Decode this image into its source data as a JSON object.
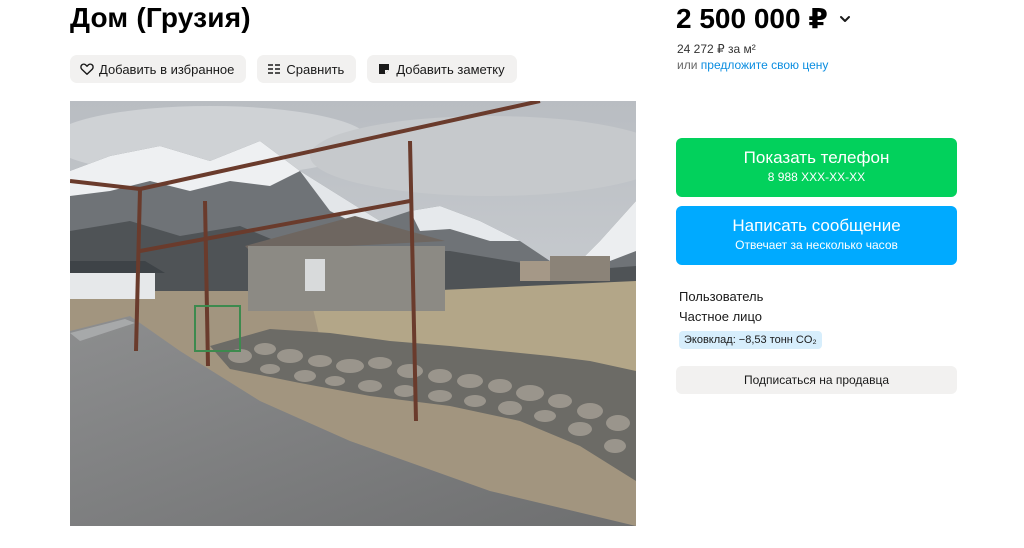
{
  "listing": {
    "title": "Дом (Грузия)",
    "price": "2 500 000 ₽",
    "price_per_m2": "24 272 ₽ за м²",
    "offer_prefix": "или",
    "offer_link": "предложите свою цену"
  },
  "actions": {
    "favorite": "Добавить в избранное",
    "compare": "Сравнить",
    "note": "Добавить заметку"
  },
  "contact": {
    "phone_title": "Показать телефон",
    "phone_number": "8 988 XXX-XX-XX",
    "message_title": "Написать сообщение",
    "message_sub": "Отвечает за несколько часов"
  },
  "seller": {
    "role": "Пользователь",
    "type": "Частное лицо",
    "eco": "Эковклад: −8,53 тонн CO₂",
    "subscribe": "Подписаться на продавца"
  },
  "colors": {
    "green": "#02d15c",
    "blue": "#00aaff",
    "link": "#0a8de0",
    "chip": "#f2f1f0"
  },
  "icons": [
    "heart-icon",
    "compare-icon",
    "note-icon",
    "chevron-down-icon"
  ]
}
